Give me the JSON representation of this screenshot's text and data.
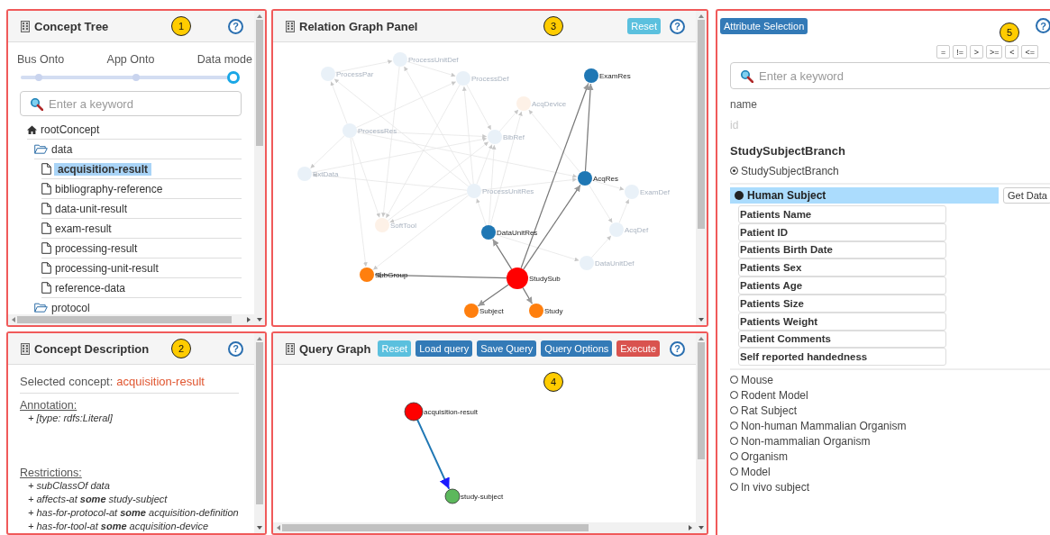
{
  "concept_tree": {
    "title": "Concept Tree",
    "badge": "1",
    "help": "?",
    "slider": {
      "stops": [
        {
          "label": "Bus Onto",
          "selected": false
        },
        {
          "label": "App Onto",
          "selected": false
        },
        {
          "label": "Data mode",
          "selected": true
        }
      ],
      "level": 1
    },
    "search": {
      "placeholder": "Enter a keyword"
    },
    "tree": [
      {
        "label": "rootConcept",
        "kind": "root",
        "selected": false,
        "children": [
          {
            "label": "data",
            "kind": "folder",
            "selected": false,
            "children": [
              {
                "label": "acquisition-result",
                "kind": "file",
                "selected": true
              },
              {
                "label": "bibliography-reference",
                "kind": "file",
                "selected": false
              },
              {
                "label": "data-unit-result",
                "kind": "file",
                "selected": false
              },
              {
                "label": "exam-result",
                "kind": "file",
                "selected": false
              },
              {
                "label": "processing-result",
                "kind": "file",
                "selected": false
              },
              {
                "label": "processing-unit-result",
                "kind": "file",
                "selected": false
              },
              {
                "label": "reference-data",
                "kind": "file",
                "selected": false
              }
            ]
          },
          {
            "label": "protocol",
            "kind": "folder",
            "selected": false
          }
        ]
      }
    ]
  },
  "concept_description": {
    "title": "Concept Description",
    "badge": "2",
    "help": "?",
    "selected_label": "Selected concept:",
    "selected_value": "acquisition-result",
    "annotation_heading": "Annotation:",
    "annotations": [
      "+ [type: rdfs:Literal]"
    ],
    "restrictions_heading": "Restrictions:",
    "restrictions": [
      "+ subClassOf data",
      "+ affects-at **some** study-subject",
      "+ has-for-protocol-at **some** acquisition-definition",
      "+ has-for-tool-at **some** acquisition-device"
    ]
  },
  "relation_graph": {
    "title": "Relation Graph Panel",
    "badge": "3",
    "reset_button": "Reset",
    "help": "?",
    "nodes": [
      {
        "label": "ProcessUnitDef",
        "color": "#e9f1f8",
        "faded": true
      },
      {
        "label": "ProcessPar",
        "color": "#e9f1f8",
        "faded": true
      },
      {
        "label": "ProcessDef",
        "color": "#e9f1f8",
        "faded": true
      },
      {
        "label": "ExamRes",
        "color": "#1f77b4",
        "faded": false
      },
      {
        "label": "AcqDevice",
        "color": "#fdf1e7",
        "faded": true
      },
      {
        "label": "ProcessRes",
        "color": "#e9f1f8",
        "faded": true
      },
      {
        "label": "BibRef",
        "color": "#e9f1f8",
        "faded": true
      },
      {
        "label": "ExtData",
        "color": "#e9f1f8",
        "faded": true
      },
      {
        "label": "AcqRes",
        "color": "#1f77b4",
        "faded": false
      },
      {
        "label": "ProcessUnitRes",
        "color": "#e9f1f8",
        "faded": true
      },
      {
        "label": "ExamDef",
        "color": "#e9f1f8",
        "faded": true
      },
      {
        "label": "SoftTool",
        "color": "#fdf1e7",
        "faded": true
      },
      {
        "label": "DataUnitRes",
        "color": "#1f77b4",
        "faded": false
      },
      {
        "label": "AcqDef",
        "color": "#e9f1f8",
        "faded": true
      },
      {
        "label": "DataUnitDef",
        "color": "#e9f1f8",
        "faded": true
      },
      {
        "label": "SubGroup",
        "color": "#ff7f0e",
        "faded": false
      },
      {
        "label": "StudySub",
        "color": "#ff0000",
        "faded": false
      },
      {
        "label": "Subject",
        "color": "#ff7f0e",
        "faded": false
      },
      {
        "label": "Study",
        "color": "#ff7f0e",
        "faded": false
      }
    ]
  },
  "query_graph": {
    "title": "Query Graph",
    "badge": "4",
    "help": "?",
    "buttons": [
      {
        "label": "Reset",
        "kind": "info"
      },
      {
        "label": "Load query",
        "kind": "primary"
      },
      {
        "label": "Save Query",
        "kind": "primary"
      },
      {
        "label": "Query Options",
        "kind": "primary"
      },
      {
        "label": "Execute",
        "kind": "danger"
      }
    ],
    "nodes": [
      {
        "label": "acquisition-result",
        "color": "#ff0000"
      },
      {
        "label": "study-subject",
        "color": "#5cb85c"
      }
    ]
  },
  "attribute_selection": {
    "title_button": "Attribute Selection",
    "badge": "5",
    "help": "?",
    "operators": [
      "=",
      "!=",
      ">",
      ">=",
      "<",
      "<="
    ],
    "search": {
      "placeholder": "Enter a keyword"
    },
    "fields": [
      {
        "label": "name",
        "disabled": false
      },
      {
        "label": "id",
        "disabled": true
      }
    ],
    "branch_heading": "StudySubjectBranch",
    "branch_option": {
      "label": "StudySubjectBranch",
      "selected": true
    },
    "subjects": [
      {
        "label": "Human Subject",
        "selected": true,
        "action": "Get Data",
        "attributes": [
          "Patients Name",
          "Patient ID",
          "Patients Birth Date",
          "Patients Sex",
          "Patients Age",
          "Patients Size",
          "Patients Weight",
          "Patient Comments",
          "Self reported handedness"
        ]
      },
      {
        "label": "Mouse",
        "selected": false
      },
      {
        "label": "Rodent Model",
        "selected": false
      },
      {
        "label": "Rat Subject",
        "selected": false
      },
      {
        "label": "Non-human Mammalian Organism",
        "selected": false
      },
      {
        "label": "Non-mammalian Organism",
        "selected": false
      },
      {
        "label": "Organism",
        "selected": false
      },
      {
        "label": "Model",
        "selected": false
      },
      {
        "label": "In vivo subject",
        "selected": false
      }
    ]
  }
}
